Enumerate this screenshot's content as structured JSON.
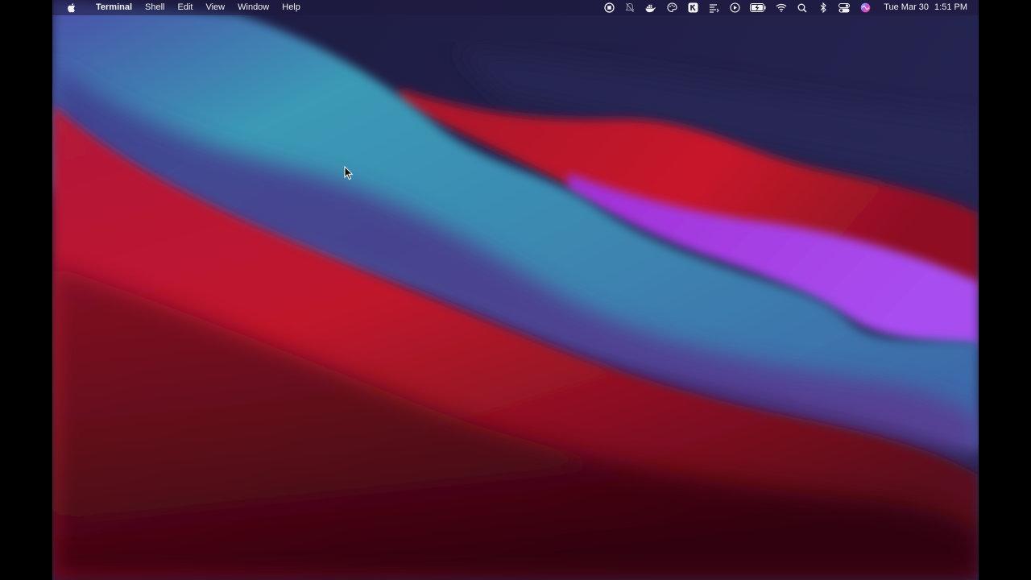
{
  "menubar": {
    "app_name": "Terminal",
    "menus": [
      "Shell",
      "Edit",
      "View",
      "Window",
      "Help"
    ],
    "status_icons": [
      "screen-record-icon",
      "notifications-off-icon",
      "docker-icon",
      "palette-icon",
      "k-app-icon",
      "text-list-icon",
      "play-icon",
      "battery-charging-icon",
      "wifi-icon",
      "spotlight-search-icon",
      "bluetooth-icon",
      "control-center-icon",
      "siri-icon"
    ],
    "date": "Tue Mar 30",
    "time": "1:51 PM"
  },
  "wallpaper": {
    "name": "macOS Big Sur dark",
    "colors": {
      "navy": "#22204a",
      "teal": "#3a9bb5",
      "indigo": "#4b3a8e",
      "red": "#c4172c",
      "magenta": "#b43ae6",
      "deep_red": "#3b0714"
    }
  }
}
